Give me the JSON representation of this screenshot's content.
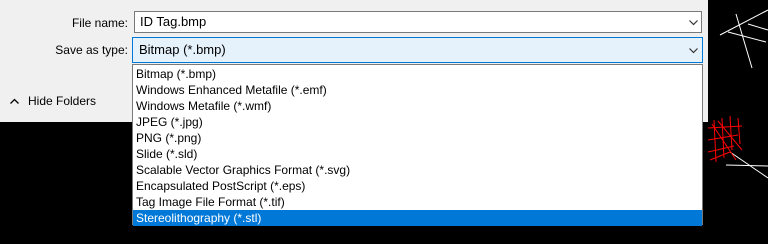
{
  "file_name": {
    "label": "File name:",
    "value": "ID Tag.bmp"
  },
  "save_as_type": {
    "label": "Save as type:",
    "value": "Bitmap (*.bmp)",
    "options": [
      "Bitmap (*.bmp)",
      "Windows Enhanced Metafile (*.emf)",
      "Windows Metafile (*.wmf)",
      "JPEG (*.jpg)",
      "PNG (*.png)",
      "Slide (*.sld)",
      "Scalable Vector Graphics Format (*.svg)",
      "Encapsulated PostScript (*.eps)",
      "Tag Image File Format (*.tif)",
      "Stereolithography (*.stl)"
    ],
    "highlighted_option": "Stereolithography (*.stl)"
  },
  "hide_folders": {
    "label": "Hide Folders",
    "icon": "chevron-up-icon"
  },
  "colors": {
    "dialog_bg": "#f0f0f0",
    "accent": "#0078d7",
    "selected_field_bg": "#e5f1fb",
    "background": "#000000",
    "drawing_lines": "#ff0000"
  }
}
